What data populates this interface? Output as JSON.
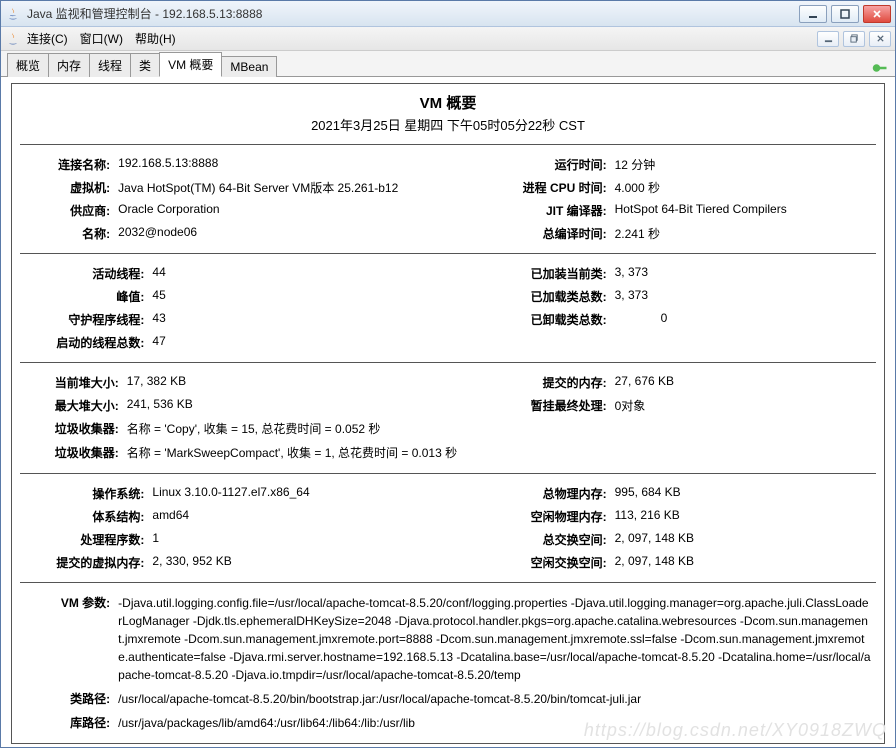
{
  "outerTitle": "Java 监视和管理控制台 - 192.168.5.13:8888",
  "menus": {
    "connect": "连接(C)",
    "window": "窗口(W)",
    "help": "帮助(H)"
  },
  "tabs": [
    "概览",
    "内存",
    "线程",
    "类",
    "VM 概要",
    "MBean"
  ],
  "activeTab": "VM 概要",
  "header": {
    "title": "VM 概要",
    "timestamp": "2021年3月25日 星期四 下午05时05分22秒 CST"
  },
  "section1": {
    "left": [
      {
        "label": "连接名称:",
        "value": "192.168.5.13:8888"
      },
      {
        "label": "虚拟机:",
        "value": "Java HotSpot(TM) 64-Bit Server VM版本 25.261-b12"
      },
      {
        "label": "供应商:",
        "value": "Oracle Corporation"
      },
      {
        "label": "名称:",
        "value": "2032@node06"
      }
    ],
    "right": [
      {
        "label": "运行时间:",
        "value": "12 分钟"
      },
      {
        "label": "进程 CPU 时间:",
        "value": "4.000 秒"
      },
      {
        "label": "JIT 编译器:",
        "value": "HotSpot 64-Bit Tiered Compilers"
      },
      {
        "label": "总编译时间:",
        "value": "2.241 秒"
      }
    ]
  },
  "section2": {
    "left": [
      {
        "label": "活动线程:",
        "value": "44"
      },
      {
        "label": "峰值:",
        "value": "45"
      },
      {
        "label": "守护程序线程:",
        "value": "43"
      },
      {
        "label": "启动的线程总数:",
        "value": "47"
      }
    ],
    "right": [
      {
        "label": "已加装当前类:",
        "value": "3, 373"
      },
      {
        "label": "已加载类总数:",
        "value": "3, 373"
      },
      {
        "label": "已卸载类总数:",
        "value": "0"
      },
      {
        "label": "",
        "value": ""
      }
    ]
  },
  "section3": {
    "left": [
      {
        "label": "当前堆大小:",
        "value": "17, 382 KB"
      },
      {
        "label": "最大堆大小:",
        "value": "241, 536 KB"
      }
    ],
    "right": [
      {
        "label": "提交的内存:",
        "value": "27, 676 KB"
      },
      {
        "label": "暂挂最终处理:",
        "value": "0对象"
      }
    ],
    "gc": [
      {
        "label": "垃圾收集器:",
        "value": "名称 = 'Copy', 收集 = 15, 总花费时间 = 0.052 秒"
      },
      {
        "label": "垃圾收集器:",
        "value": "名称 = 'MarkSweepCompact', 收集 = 1, 总花费时间 = 0.013 秒"
      }
    ]
  },
  "section4": {
    "left": [
      {
        "label": "操作系统:",
        "value": "Linux 3.10.0-1127.el7.x86_64"
      },
      {
        "label": "体系结构:",
        "value": "amd64"
      },
      {
        "label": "处理程序数:",
        "value": "1"
      },
      {
        "label": "提交的虚拟内存:",
        "value": "2, 330, 952 KB"
      }
    ],
    "right": [
      {
        "label": "总物理内存:",
        "value": "995, 684 KB"
      },
      {
        "label": "空闲物理内存:",
        "value": "113, 216 KB"
      },
      {
        "label": "总交换空间:",
        "value": "2, 097, 148 KB"
      },
      {
        "label": "空闲交换空间:",
        "value": "2, 097, 148 KB"
      }
    ]
  },
  "section5": {
    "rows": [
      {
        "label": "VM 参数:",
        "value": "-Djava.util.logging.config.file=/usr/local/apache-tomcat-8.5.20/conf/logging.properties -Djava.util.logging.manager=org.apache.juli.ClassLoaderLogManager -Djdk.tls.ephemeralDHKeySize=2048 -Djava.protocol.handler.pkgs=org.apache.catalina.webresources -Dcom.sun.management.jmxremote -Dcom.sun.management.jmxremote.port=8888 -Dcom.sun.management.jmxremote.ssl=false -Dcom.sun.management.jmxremote.authenticate=false -Djava.rmi.server.hostname=192.168.5.13 -Dcatalina.base=/usr/local/apache-tomcat-8.5.20 -Dcatalina.home=/usr/local/apache-tomcat-8.5.20 -Djava.io.tmpdir=/usr/local/apache-tomcat-8.5.20/temp"
      },
      {
        "label": "类路径:",
        "value": "/usr/local/apache-tomcat-8.5.20/bin/bootstrap.jar:/usr/local/apache-tomcat-8.5.20/bin/tomcat-juli.jar"
      },
      {
        "label": "库路径:",
        "value": "/usr/java/packages/lib/amd64:/usr/lib64:/lib64:/lib:/usr/lib"
      }
    ]
  },
  "watermark": "https://blog.csdn.net/XY0918ZWQ"
}
